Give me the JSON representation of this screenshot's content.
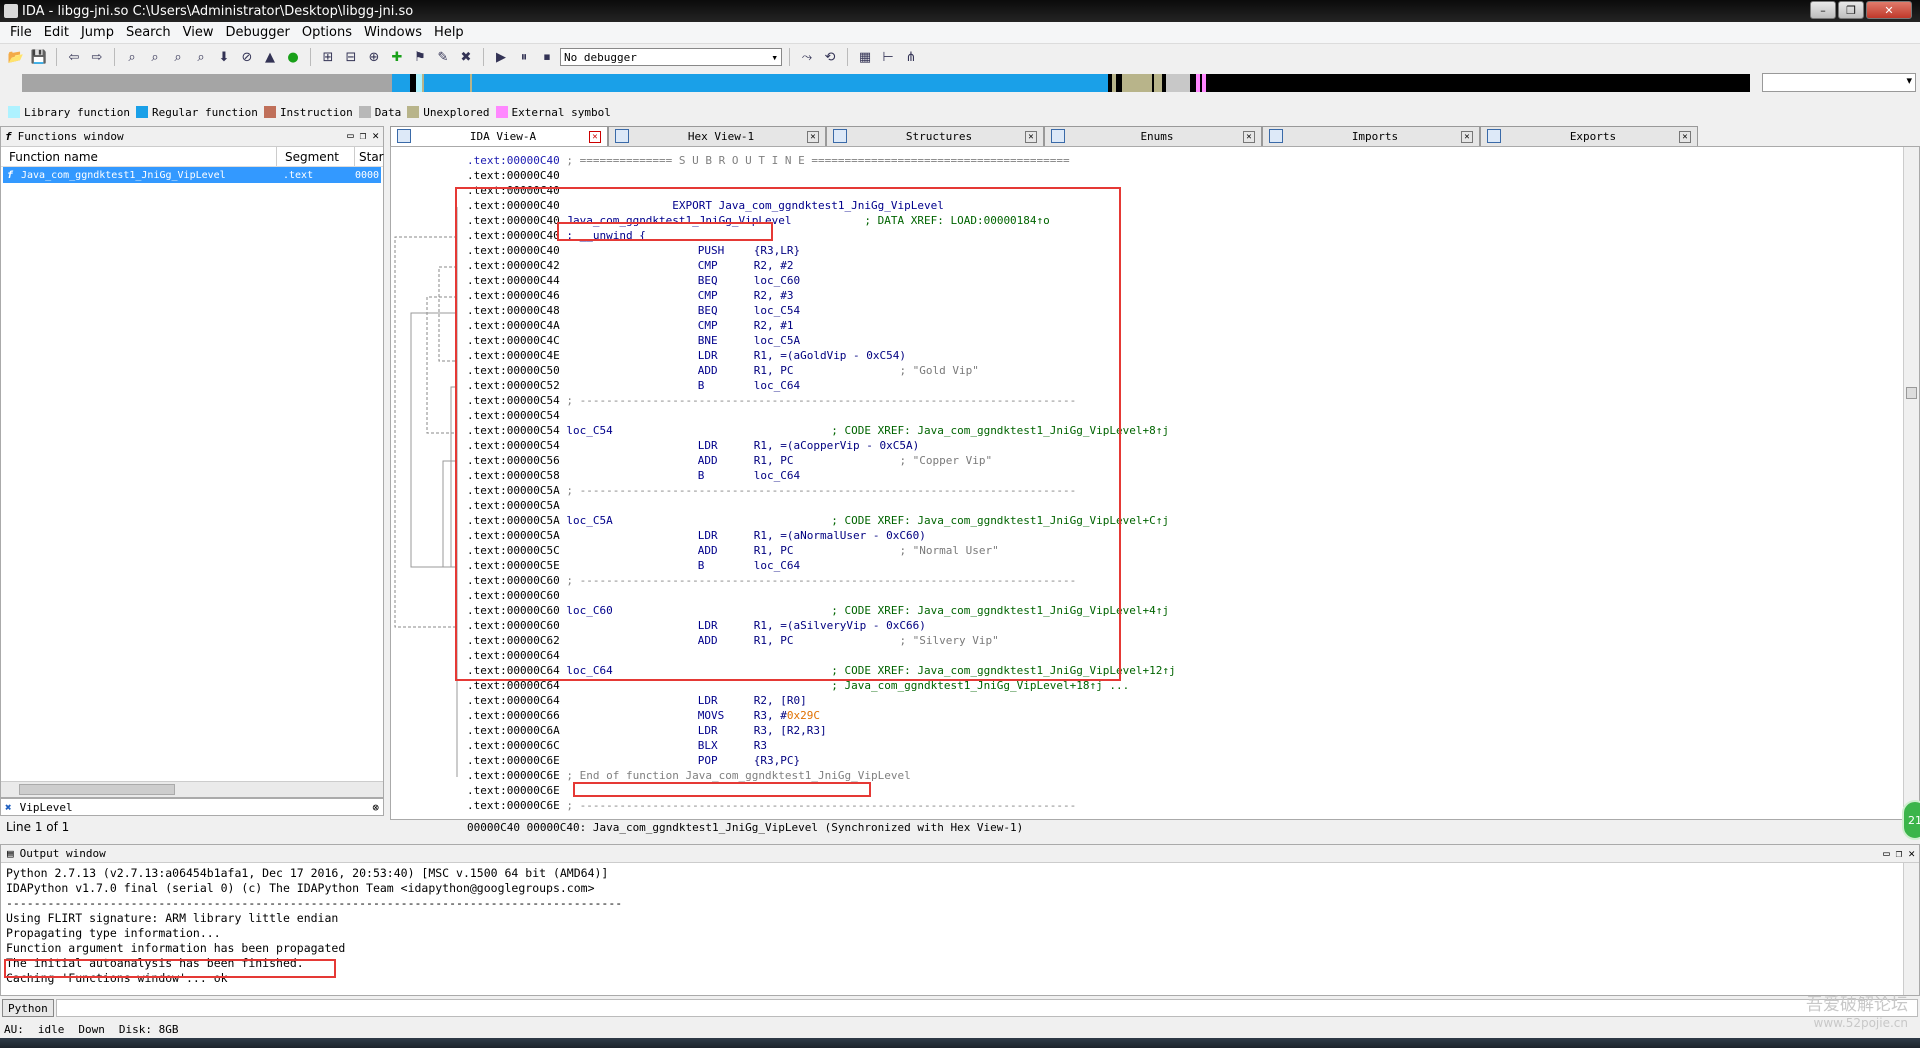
{
  "window": {
    "title": "IDA - libgg-jni.so C:\\Users\\Administrator\\Desktop\\libgg-jni.so"
  },
  "menu": [
    "File",
    "Edit",
    "Jump",
    "Search",
    "View",
    "Debugger",
    "Options",
    "Windows",
    "Help"
  ],
  "toolbar": {
    "debugger_select": "No debugger"
  },
  "legend": [
    {
      "label": "Library function",
      "color": "#aef2ff"
    },
    {
      "label": "Regular function",
      "color": "#1aa0e8"
    },
    {
      "label": "Instruction",
      "color": "#c0705a"
    },
    {
      "label": "Data",
      "color": "#b8b8b8"
    },
    {
      "label": "Unexplored",
      "color": "#b8b48a"
    },
    {
      "label": "External symbol",
      "color": "#ff88ff"
    }
  ],
  "functions_window": {
    "title": "Functions window",
    "columns": [
      "Function name",
      "Segment",
      "Star"
    ],
    "rows": [
      {
        "name": "Java_com_ggndktest1_JniGg_VipLevel",
        "segment": ".text",
        "start": "0000"
      }
    ],
    "filter": "VipLevel",
    "line_count": "Line 1 of 1"
  },
  "tabs": [
    {
      "label": "IDA View-A",
      "active": true
    },
    {
      "label": "Hex View-1",
      "active": false
    },
    {
      "label": "Structures",
      "active": false
    },
    {
      "label": "Enums",
      "active": false
    },
    {
      "label": "Imports",
      "active": false
    },
    {
      "label": "Exports",
      "active": false
    }
  ],
  "disasm": {
    "lines": [
      {
        "addr": ".text:00000C40",
        "addr_blue": true,
        "text": " ; ============== S U B R O U T I N E =======================================",
        "kind": "sep"
      },
      {
        "addr": ".text:00000C40",
        "text": "",
        "kind": "plain"
      },
      {
        "addr": ".text:00000C40",
        "text": "",
        "kind": "plain"
      },
      {
        "addr": ".text:00000C40",
        "text": "                 EXPORT Java_com_ggndktest1_JniGg_VipLevel",
        "kind": "mn"
      },
      {
        "addr": ".text:00000C40",
        "text": " Java_com_ggndktest1_JniGg_VipLevel",
        "comment": "           ; DATA XREF: LOAD:00000184↑o",
        "kind": "lbl"
      },
      {
        "addr": ".text:00000C40",
        "text": " ; __unwind {",
        "kind": "lbl"
      },
      {
        "addr": ".text:00000C40",
        "mn": "PUSH",
        "op": "{R3,LR}",
        "kind": "ins"
      },
      {
        "addr": ".text:00000C42",
        "mn": "CMP",
        "op": "R2, #2",
        "kind": "ins"
      },
      {
        "addr": ".text:00000C44",
        "mn": "BEQ",
        "op": "loc_C60",
        "kind": "ins"
      },
      {
        "addr": ".text:00000C46",
        "mn": "CMP",
        "op": "R2, #3",
        "kind": "ins"
      },
      {
        "addr": ".text:00000C48",
        "mn": "BEQ",
        "op": "loc_C54",
        "kind": "ins"
      },
      {
        "addr": ".text:00000C4A",
        "mn": "CMP",
        "op": "R2, #1",
        "kind": "ins"
      },
      {
        "addr": ".text:00000C4C",
        "mn": "BNE",
        "op": "loc_C5A",
        "kind": "ins"
      },
      {
        "addr": ".text:00000C4E",
        "mn": "LDR",
        "op": "R1, =(aGoldVip - 0xC54)",
        "kind": "ins"
      },
      {
        "addr": ".text:00000C50",
        "mn": "ADD",
        "op": "R1, PC",
        "str": "; \"Gold Vip\"",
        "kind": "ins"
      },
      {
        "addr": ".text:00000C52",
        "mn": "B",
        "op": "loc_C64",
        "kind": "ins"
      },
      {
        "addr": ".text:00000C54",
        "text": " ; ---------------------------------------------------------------------------",
        "kind": "sep"
      },
      {
        "addr": ".text:00000C54",
        "text": "",
        "kind": "plain"
      },
      {
        "addr": ".text:00000C54",
        "text": " loc_C54",
        "comment": "                                 ; CODE XREF: Java_com_ggndktest1_JniGg_VipLevel+8↑j",
        "kind": "lbl"
      },
      {
        "addr": ".text:00000C54",
        "mn": "LDR",
        "op": "R1, =(aCopperVip - 0xC5A)",
        "kind": "ins"
      },
      {
        "addr": ".text:00000C56",
        "mn": "ADD",
        "op": "R1, PC",
        "str": "; \"Copper Vip\"",
        "kind": "ins"
      },
      {
        "addr": ".text:00000C58",
        "mn": "B",
        "op": "loc_C64",
        "kind": "ins"
      },
      {
        "addr": ".text:00000C5A",
        "text": " ; ---------------------------------------------------------------------------",
        "kind": "sep"
      },
      {
        "addr": ".text:00000C5A",
        "text": "",
        "kind": "plain"
      },
      {
        "addr": ".text:00000C5A",
        "text": " loc_C5A",
        "comment": "                                 ; CODE XREF: Java_com_ggndktest1_JniGg_VipLevel+C↑j",
        "kind": "lbl"
      },
      {
        "addr": ".text:00000C5A",
        "mn": "LDR",
        "op": "R1, =(aNormalUser - 0xC60)",
        "kind": "ins"
      },
      {
        "addr": ".text:00000C5C",
        "mn": "ADD",
        "op": "R1, PC",
        "str": "; \"Normal User\"",
        "kind": "ins"
      },
      {
        "addr": ".text:00000C5E",
        "mn": "B",
        "op": "loc_C64",
        "kind": "ins"
      },
      {
        "addr": ".text:00000C60",
        "text": " ; ---------------------------------------------------------------------------",
        "kind": "sep"
      },
      {
        "addr": ".text:00000C60",
        "text": "",
        "kind": "plain"
      },
      {
        "addr": ".text:00000C60",
        "text": " loc_C60",
        "comment": "                                 ; CODE XREF: Java_com_ggndktest1_JniGg_VipLevel+4↑j",
        "kind": "lbl"
      },
      {
        "addr": ".text:00000C60",
        "mn": "LDR",
        "op": "R1, =(aSilveryVip - 0xC66)",
        "kind": "ins"
      },
      {
        "addr": ".text:00000C62",
        "mn": "ADD",
        "op": "R1, PC",
        "str": "; \"Silvery Vip\"",
        "kind": "ins"
      },
      {
        "addr": ".text:00000C64",
        "text": "",
        "kind": "plain"
      },
      {
        "addr": ".text:00000C64",
        "text": " loc_C64",
        "comment": "                                 ; CODE XREF: Java_com_ggndktest1_JniGg_VipLevel+12↑j",
        "kind": "lbl"
      },
      {
        "addr": ".text:00000C64",
        "text": "",
        "comment": "                                         ; Java_com_ggndktest1_JniGg_VipLevel+18↑j ...",
        "kind": "lbl"
      },
      {
        "addr": ".text:00000C64",
        "mn": "LDR",
        "op": "R2, [R0]",
        "kind": "ins"
      },
      {
        "addr": ".text:00000C66",
        "mn": "MOVS",
        "op": "R3, #",
        "hex": "0x29C",
        "kind": "ins"
      },
      {
        "addr": ".text:00000C6A",
        "mn": "LDR",
        "op": "R3, [R2,R3]",
        "kind": "ins"
      },
      {
        "addr": ".text:00000C6C",
        "mn": "BLX",
        "op": "R3",
        "kind": "ins"
      },
      {
        "addr": ".text:00000C6E",
        "mn": "POP",
        "op": "{R3,PC}",
        "kind": "ins"
      },
      {
        "addr": ".text:00000C6E",
        "text": " ; End of function Java_com_ggndktest1_JniGg_VipLevel",
        "kind": "gray"
      },
      {
        "addr": ".text:00000C6E",
        "text": "",
        "kind": "plain"
      },
      {
        "addr": ".text:00000C6E",
        "text": " ; ---------------------------------------------------------------------------",
        "kind": "sep"
      }
    ],
    "status": "00000C40 00000C40: Java_com_ggndktest1_JniGg_VipLevel (Synchronized with Hex View-1)"
  },
  "output_window": {
    "title": "Output window",
    "lines": [
      "Python 2.7.13 (v2.7.13:a06454b1afa1, Dec 17 2016, 20:53:40) [MSC v.1500 64 bit (AMD64)]",
      "IDAPython v1.7.0 final (serial 0) (c) The IDAPython Team <idapython@googlegroups.com>",
      "-----------------------------------------------------------------------------------------",
      "Using FLIRT signature: ARM library little endian",
      "Propagating type information...",
      "Function argument information has been propagated",
      "The initial autoanalysis has been finished.",
      "Caching 'Functions window'... ok"
    ],
    "python_button": "Python"
  },
  "statusbar": {
    "au": "AU:",
    "state": "idle",
    "direction": "Down",
    "disk": "Disk: 8GB"
  },
  "watermark": {
    "line1": "吾爱破解论坛",
    "line2": "www.52pojie.cn"
  },
  "badge": "21"
}
